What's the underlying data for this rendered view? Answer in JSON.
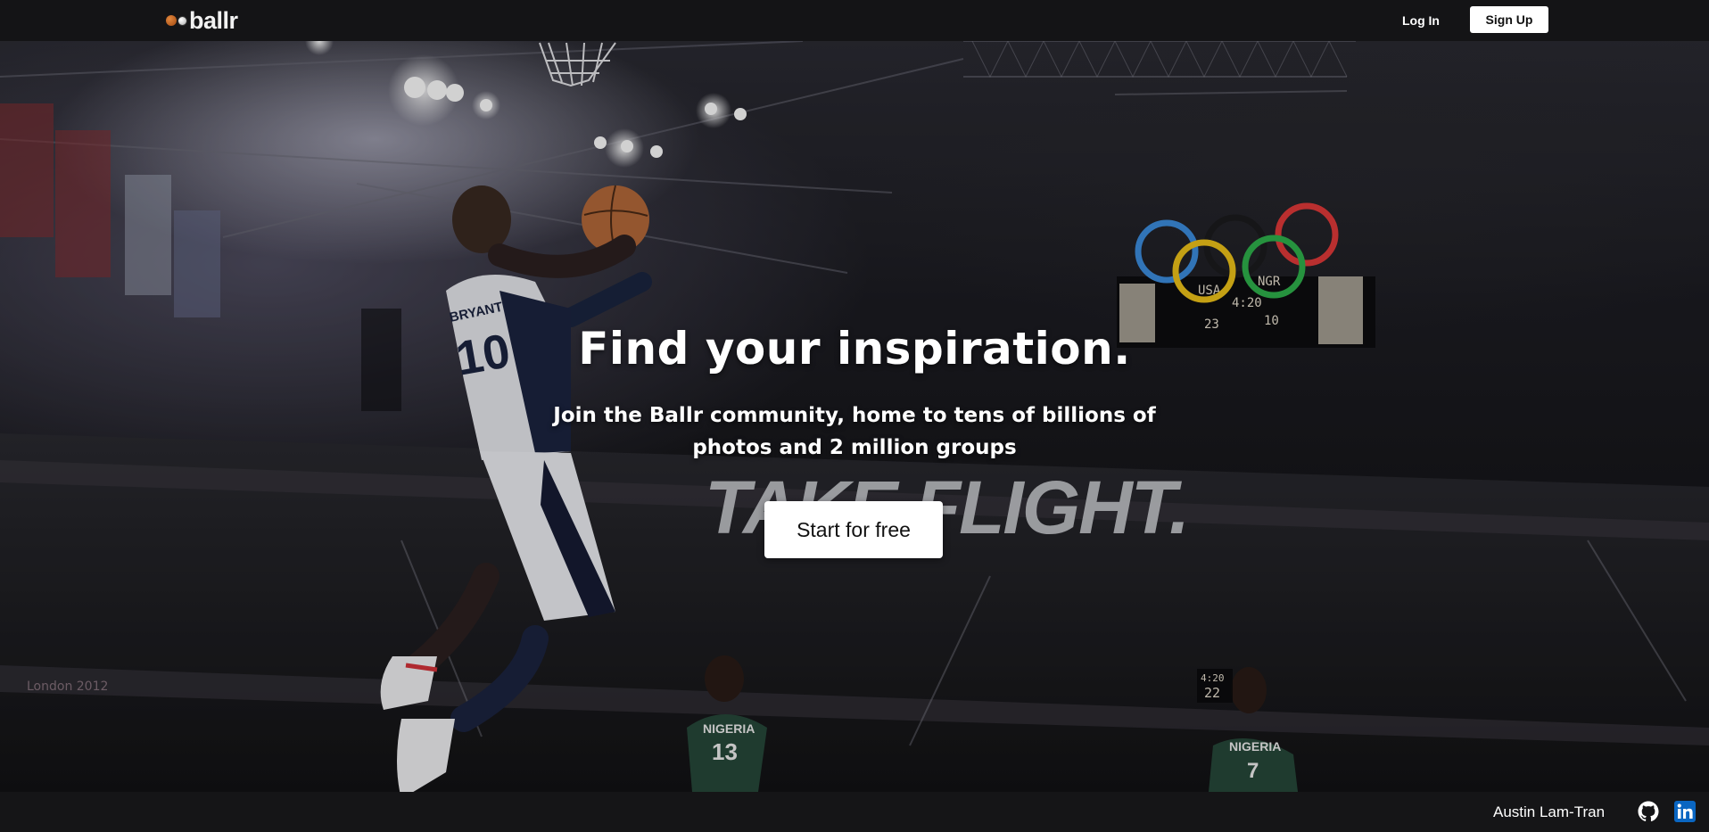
{
  "brand": {
    "name": "ballr",
    "logo_icons": [
      "basketball-icon",
      "soccer-ball-icon"
    ]
  },
  "nav": {
    "login_label": "Log In",
    "signup_label": "Sign Up"
  },
  "hero": {
    "headline": "Find your inspiration.",
    "subheadline": "Join the Ballr community, home to tens of billions of photos and 2 million groups",
    "cta_label": "Start for free",
    "background_text": "TAKE FLIGHT.",
    "player_name": "BRYANT",
    "player_number": "10",
    "nigeria_label": "NIGERIA",
    "nigeria_numbers": [
      "13",
      "7"
    ],
    "event_mark": "London 2012",
    "scoreboard": {
      "home": "USA",
      "away": "NGR",
      "clock": "4:20",
      "home_score": "23",
      "away_score": "10"
    },
    "shot_clock": [
      "4:20",
      "22"
    ]
  },
  "footer": {
    "author": "Austin Lam-Tran",
    "icons": [
      "github-icon",
      "linkedin-icon"
    ]
  },
  "colors": {
    "topbar": "#141416",
    "footer": "#151517",
    "cta_bg": "#ffffff",
    "linkedin": "#0a66c2"
  }
}
